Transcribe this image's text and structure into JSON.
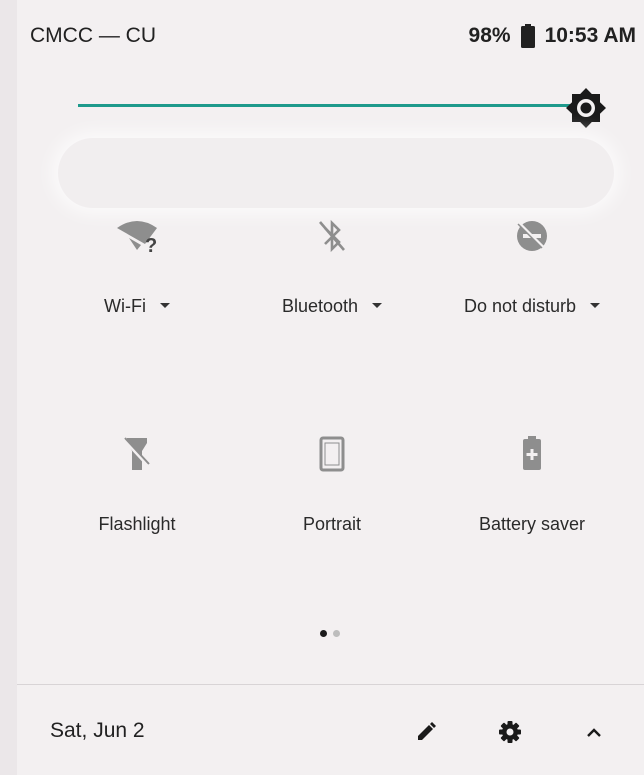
{
  "status_bar": {
    "carrier": "CMCC — CU",
    "battery": "98%",
    "time": "10:53 AM"
  },
  "brightness": {
    "level": 1.0,
    "accent": "#1e9a8c"
  },
  "tiles": [
    {
      "label": "Wi-Fi",
      "icon": "wifi-unknown-icon",
      "has_dropdown": true
    },
    {
      "label": "Bluetooth",
      "icon": "bluetooth-disabled-icon",
      "has_dropdown": true
    },
    {
      "label": "Do not disturb",
      "icon": "do-not-disturb-off-icon",
      "has_dropdown": true
    },
    {
      "label": "Flashlight",
      "icon": "flashlight-off-icon",
      "has_dropdown": false
    },
    {
      "label": "Portrait",
      "icon": "portrait-icon",
      "has_dropdown": false
    },
    {
      "label": "Battery saver",
      "icon": "battery-saver-icon",
      "has_dropdown": false
    }
  ],
  "pager": {
    "current": 1,
    "total": 2
  },
  "footer": {
    "date": "Sat, Jun 2",
    "icons": [
      "edit-icon",
      "settings-icon",
      "collapse-icon"
    ]
  }
}
